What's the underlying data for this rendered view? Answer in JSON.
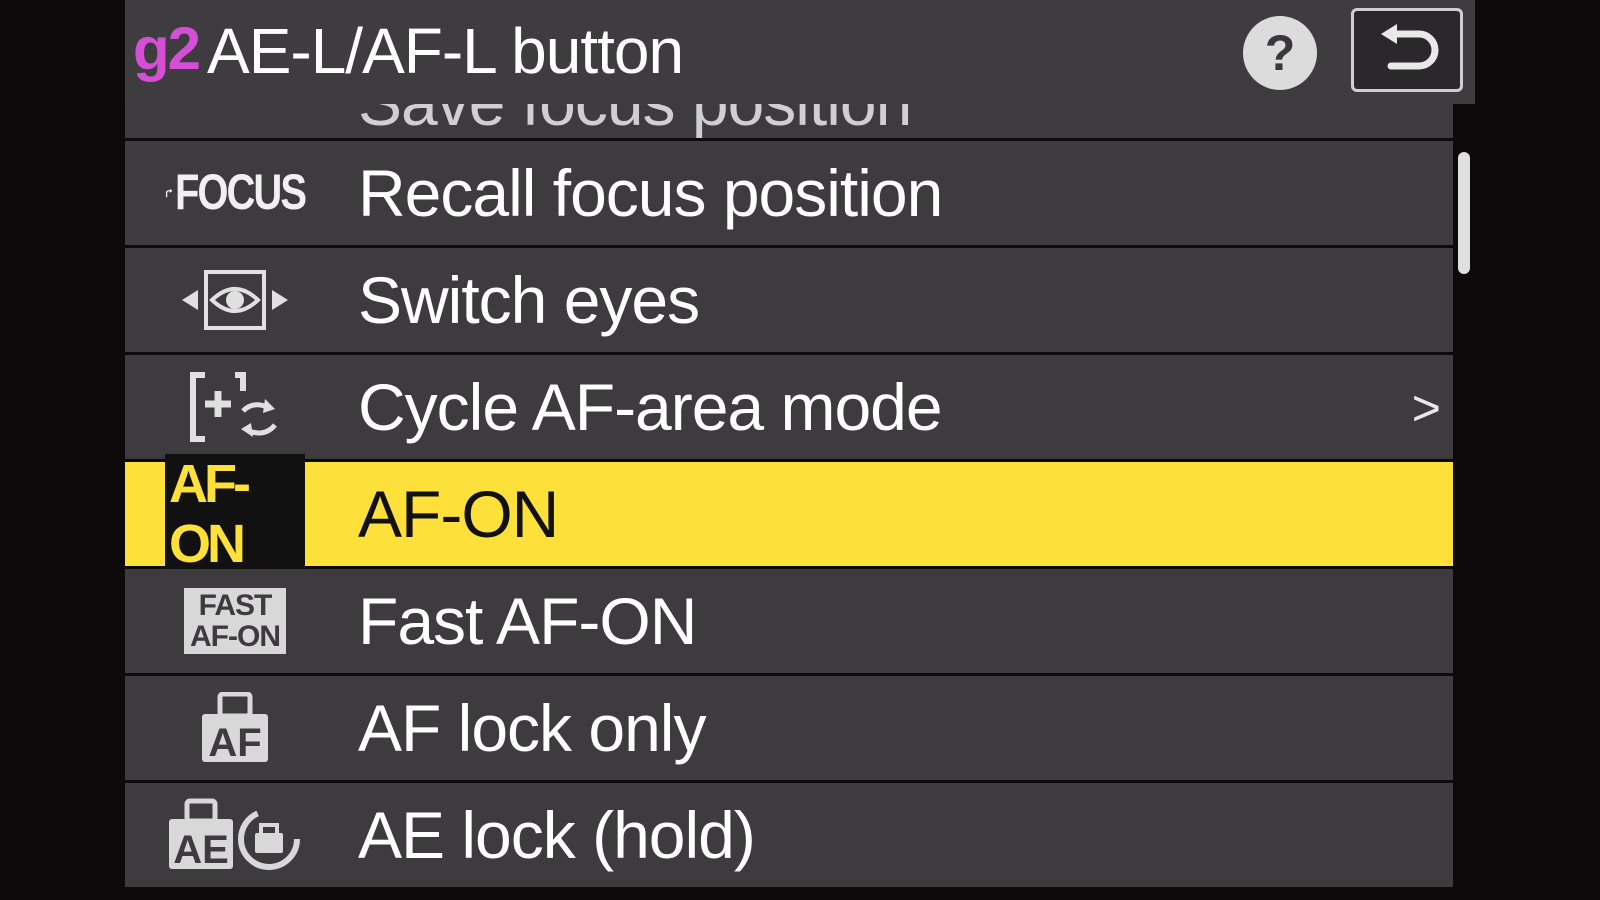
{
  "header": {
    "code": "g2",
    "title": "AE-L/AF-L button"
  },
  "list": {
    "items": [
      {
        "label": "Save focus position",
        "icon": "save-focus-icon"
      },
      {
        "label": "Recall focus position",
        "icon": "recall-focus-icon",
        "icon_text": "FOCUS"
      },
      {
        "label": "Switch eyes",
        "icon": "switch-eyes-icon"
      },
      {
        "label": "Cycle AF-area mode",
        "icon": "cycle-af-area-icon",
        "has_submenu": true
      },
      {
        "label": "AF-ON",
        "icon": "af-on-icon",
        "icon_text": "AF-ON",
        "selected": true
      },
      {
        "label": "Fast AF-ON",
        "icon": "fast-af-on-icon",
        "icon_text_1": "FAST",
        "icon_text_2": "AF-ON"
      },
      {
        "label": "AF lock only",
        "icon": "af-lock-icon",
        "icon_text": "AF"
      },
      {
        "label": "AE lock (hold)",
        "icon": "ae-lock-hold-icon",
        "icon_text": "AE"
      }
    ]
  },
  "colors": {
    "accent_selected": "#fde03a",
    "menu_code": "#d44fd6",
    "row_bg": "#3d3b3e"
  }
}
